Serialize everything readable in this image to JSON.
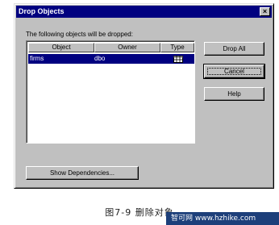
{
  "window": {
    "title": "Drop Objects",
    "close_glyph": "×"
  },
  "message": "The following objects will be dropped:",
  "list": {
    "columns": [
      "Object",
      "Owner",
      "Type"
    ],
    "rows": [
      {
        "object": "firms",
        "owner": "dbo",
        "type_icon": "table-icon"
      }
    ]
  },
  "buttons": {
    "drop_all": "Drop All",
    "cancel": "Cancel",
    "help": "Help",
    "show_dependencies": "Show Dependencies..."
  },
  "caption": "图7-9 删除对象",
  "watermark": "智可网 www.hzhike.com",
  "colors": {
    "titlebar": "#000080",
    "selection": "#000080",
    "face": "#c0c0c0"
  }
}
